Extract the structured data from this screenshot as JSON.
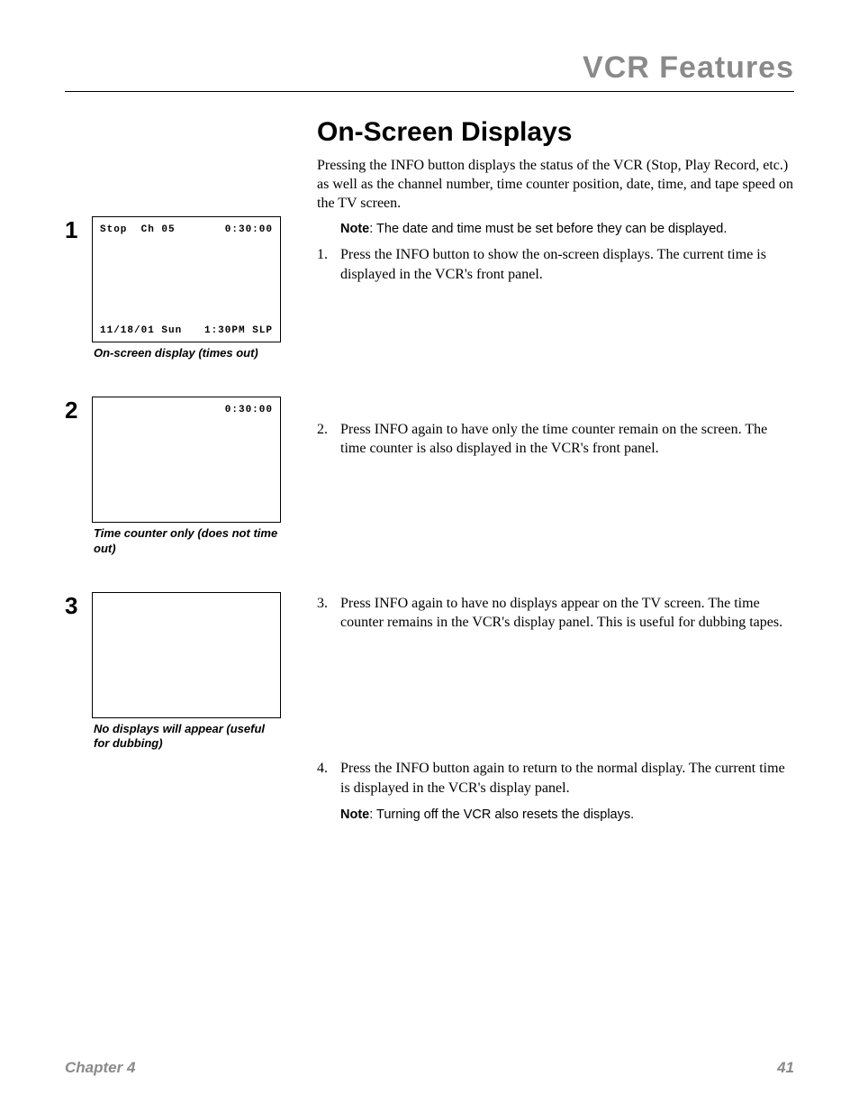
{
  "header": {
    "title": "VCR Features"
  },
  "section": {
    "title": "On-Screen Displays",
    "intro": "Pressing the INFO button displays the status of the VCR (Stop, Play Record, etc.) as well as the channel number, time counter position, date, time, and tape speed on the TV screen.",
    "note_label": "Note",
    "note_text": ": The date and time must be set before they can be displayed."
  },
  "steps": [
    {
      "num": "1.",
      "text": "Press the INFO button to show the on-screen displays. The current time is displayed in the VCR's front panel."
    },
    {
      "num": "2.",
      "text": "Press INFO again to have only the time counter remain on the screen. The time counter is also displayed in the VCR's front panel."
    },
    {
      "num": "3.",
      "text": "Press INFO again to have no displays appear on the TV screen. The time counter remains in the VCR's display panel. This is useful for dubbing tapes."
    },
    {
      "num": "4.",
      "text": "Press the INFO button again to return to the normal display. The current time is displayed in the VCR's display panel.",
      "note_label": "Note",
      "note_text": ": Turning off the VCR also resets the displays."
    }
  ],
  "figures": [
    {
      "big_num": "1",
      "top_left": "Stop  Ch 05",
      "top_right": "0:30:00",
      "bottom_left": "11/18/01 Sun",
      "bottom_right": "1:30PM SLP",
      "caption": "On-screen display (times out)"
    },
    {
      "big_num": "2",
      "top_left": "",
      "top_right": "0:30:00",
      "bottom_left": "",
      "bottom_right": "",
      "caption": "Time counter only (does not time out)"
    },
    {
      "big_num": "3",
      "top_left": "",
      "top_right": "",
      "bottom_left": "",
      "bottom_right": "",
      "caption": "No displays will appear (useful for dubbing)"
    }
  ],
  "footer": {
    "chapter": "Chapter 4",
    "page": "41"
  }
}
